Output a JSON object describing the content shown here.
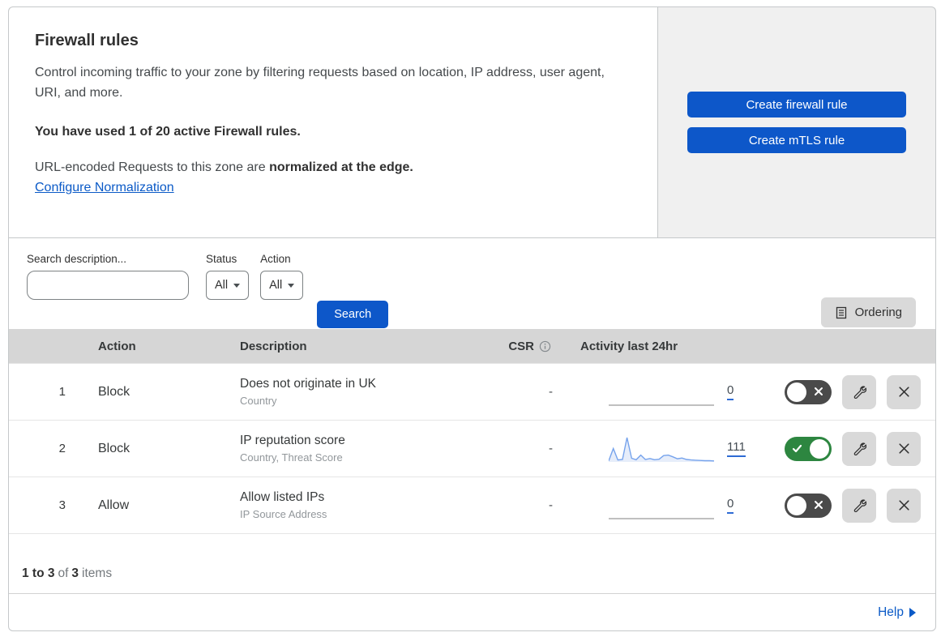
{
  "header": {
    "title": "Firewall rules",
    "description": "Control incoming traffic to your zone by filtering requests based on location, IP address, user agent, URI, and more.",
    "usage_text": "You have used 1 of 20 active Firewall rules.",
    "normalization_prefix": "URL-encoded Requests to this zone are ",
    "normalization_bold": "normalized at the edge.",
    "normalization_link": "Configure Normalization",
    "create_firewall_button": "Create firewall rule",
    "create_mtls_button": "Create mTLS rule"
  },
  "filters": {
    "search_label": "Search description...",
    "search_value": "",
    "status_label": "Status",
    "status_value": "All",
    "action_label": "Action",
    "action_value": "All",
    "search_button": "Search",
    "ordering_button": "Ordering"
  },
  "table": {
    "columns": {
      "action": "Action",
      "description": "Description",
      "csr": "CSR",
      "activity": "Activity last 24hr"
    },
    "rows": [
      {
        "priority": "1",
        "action": "Block",
        "description": "Does not originate in UK",
        "criteria": "Country",
        "csr": "-",
        "activity_count": "0",
        "enabled": false,
        "sparkline": []
      },
      {
        "priority": "2",
        "action": "Block",
        "description": "IP reputation score",
        "criteria": "Country, Threat Score",
        "csr": "-",
        "activity_count": "111",
        "enabled": true,
        "sparkline": [
          4,
          55,
          8,
          10,
          100,
          15,
          9,
          28,
          10,
          14,
          9,
          11,
          26,
          28,
          21,
          13,
          16,
          10,
          8,
          7,
          6,
          5,
          5,
          4
        ]
      },
      {
        "priority": "3",
        "action": "Allow",
        "description": "Allow listed IPs",
        "criteria": "IP Source Address",
        "csr": "-",
        "activity_count": "0",
        "enabled": false,
        "sparkline": []
      }
    ]
  },
  "footer": {
    "range_bold": "1 to 3",
    "of_text": "of",
    "total_bold": "3",
    "items_text": "items",
    "help_label": "Help"
  },
  "icons": {
    "search": "magnifier-icon",
    "info": "info-circle-icon",
    "ordering": "list-document-icon",
    "edit": "wrench-icon",
    "delete": "x-icon",
    "help_arrow": "triangle-right-icon"
  },
  "colors": {
    "accent_blue": "#0d57c9",
    "link_blue": "#0b5ac7",
    "toggle_on_green": "#2d8640",
    "toggle_off_gray": "#4a4a4a",
    "sparkline_blue": "#76a3ec",
    "table_header_gray": "#d6d6d6",
    "side_panel_gray": "#f0f0f0"
  }
}
